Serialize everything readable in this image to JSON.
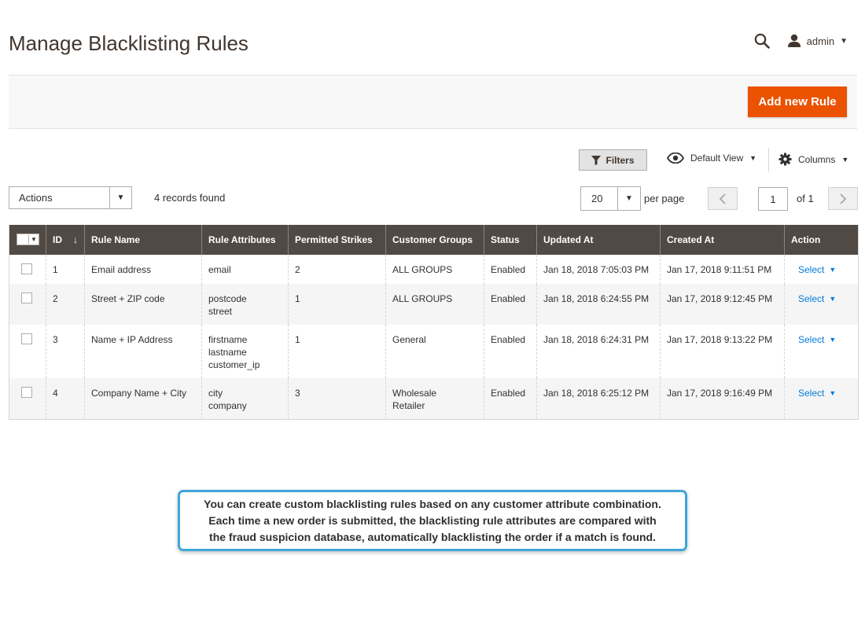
{
  "page": {
    "title": "Manage Blacklisting Rules"
  },
  "header": {
    "user": "admin",
    "search_icon": "search-icon",
    "user_icon": "user-icon"
  },
  "action_bar": {
    "add_button": "Add new Rule",
    "accent": "#eb5202"
  },
  "toolbar": {
    "filters": "Filters",
    "view": "Default View",
    "columns": "Columns",
    "actions": "Actions",
    "records_found": "4 records found",
    "per_page_value": "20",
    "per_page_label": "per page",
    "current_page": "1",
    "of_pages": "of 1"
  },
  "grid": {
    "columns": [
      "ID",
      "Rule Name",
      "Rule Attributes",
      "Permitted Strikes",
      "Customer Groups",
      "Status",
      "Updated At",
      "Created At",
      "Action"
    ],
    "header_bg": "#514943",
    "rows": [
      {
        "id": "1",
        "rule_name": "Email address",
        "attributes": [
          "email"
        ],
        "strikes": "2",
        "groups": [
          "ALL GROUPS"
        ],
        "status": "Enabled",
        "updated": "Jan 18, 2018 7:05:03 PM",
        "created": "Jan 17, 2018 9:11:51 PM",
        "action": "Select"
      },
      {
        "id": "2",
        "rule_name": "Street + ZIP code",
        "attributes": [
          "postcode",
          "street"
        ],
        "strikes": "1",
        "groups": [
          "ALL GROUPS"
        ],
        "status": "Enabled",
        "updated": "Jan 18, 2018 6:24:55 PM",
        "created": "Jan 17, 2018 9:12:45 PM",
        "action": "Select"
      },
      {
        "id": "3",
        "rule_name": "Name + IP Address",
        "attributes": [
          "firstname",
          "lastname",
          "customer_ip"
        ],
        "strikes": "1",
        "groups": [
          "General"
        ],
        "status": "Enabled",
        "updated": "Jan 18, 2018 6:24:31 PM",
        "created": "Jan 17, 2018 9:13:22 PM",
        "action": "Select"
      },
      {
        "id": "4",
        "rule_name": "Company Name + City",
        "attributes": [
          "city",
          "company"
        ],
        "strikes": "3",
        "groups": [
          "Wholesale",
          "Retailer"
        ],
        "status": "Enabled",
        "updated": "Jan 18, 2018 6:25:12 PM",
        "created": "Jan 17, 2018 9:16:49 PM",
        "action": "Select"
      }
    ]
  },
  "callout": {
    "lines": [
      "You can create custom blacklisting rules based on any customer attribute combination.",
      "Each time a new order is submitted, the blacklisting rule attributes are compared with",
      "the fraud suspicion database, automatically blacklisting the order if a match is found."
    ],
    "border_color": "#3fa6d8"
  }
}
